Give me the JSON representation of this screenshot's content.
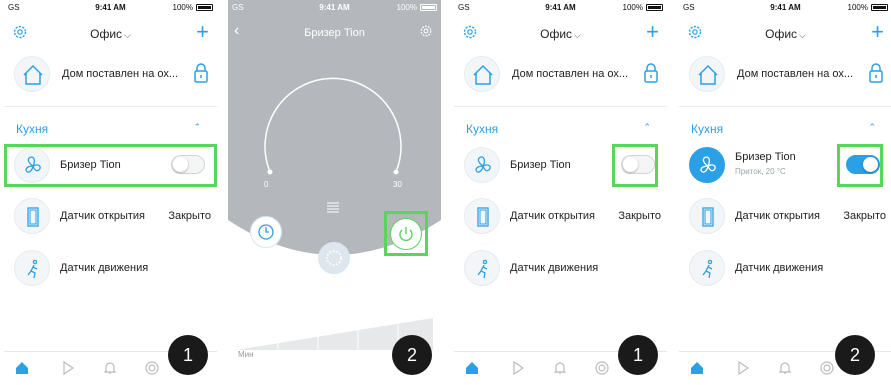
{
  "status_bar": {
    "carrier": "GS",
    "time": "9:41 AM",
    "battery": "100%"
  },
  "header": {
    "title": "Офис"
  },
  "home": {
    "label": "Дом поставлен на ох..."
  },
  "room": {
    "name": "Кухня"
  },
  "devices": {
    "breezer": {
      "name": "Бризер Tion",
      "subtitle": "Приток, 20 °C"
    },
    "door_sensor": {
      "name": "Датчик открытия",
      "state": "Закрыто"
    },
    "motion_sensor": {
      "name": "Датчик движения"
    }
  },
  "breezer_screen": {
    "title": "Бризер Tion",
    "dial_min": "0",
    "dial_max": "30",
    "speed_label": "Мин"
  },
  "badges": [
    "1",
    "2",
    "1",
    "2"
  ],
  "colors": {
    "accent": "#2aa0e6",
    "highlight": "#5bd45b",
    "grey_bg": "#b4b7bc"
  }
}
